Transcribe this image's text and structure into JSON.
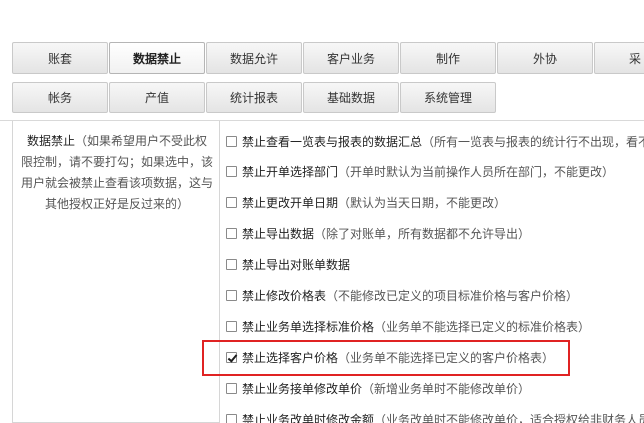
{
  "tabs_row1": [
    {
      "label": "账套",
      "active": false
    },
    {
      "label": "数据禁止",
      "active": true
    },
    {
      "label": "数据允许",
      "active": false
    },
    {
      "label": "客户业务",
      "active": false
    },
    {
      "label": "制作",
      "active": false
    },
    {
      "label": "外协",
      "active": false
    },
    {
      "label": "采",
      "active": false
    }
  ],
  "tabs_row2": [
    {
      "label": "帐务"
    },
    {
      "label": "产值"
    },
    {
      "label": "统计报表"
    },
    {
      "label": "基础数据"
    },
    {
      "label": "系统管理"
    }
  ],
  "section": {
    "title": "数据禁止",
    "description": "（如果希望用户不受此权限控制，请不要打勾；如果选中，该用户就会被禁止查看该项数据，这与其他授权正好是反过来的）"
  },
  "options": [
    {
      "label": "禁止查看一览表与报表的数据汇总",
      "desc": "（所有一览表与报表的统计行不出现，看不",
      "checked": false
    },
    {
      "label": "禁止开单选择部门",
      "desc": "（开单时默认为当前操作人员所在部门，不能更改）",
      "checked": false
    },
    {
      "label": "禁止更改开单日期",
      "desc": "（默认为当天日期，不能更改）",
      "checked": false
    },
    {
      "label": "禁止导出数据",
      "desc": "（除了对账单，所有数据都不允许导出）",
      "checked": false
    },
    {
      "label": "禁止导出对账单数据",
      "desc": "",
      "checked": false
    },
    {
      "label": "禁止修改价格表",
      "desc": "（不能修改已定义的项目标准价格与客户价格）",
      "checked": false
    },
    {
      "label": "禁止业务单选择标准价格",
      "desc": "（业务单不能选择已定义的标准价格表）",
      "checked": false
    },
    {
      "label": "禁止选择客户价格",
      "desc": "（业务单不能选择已定义的客户价格表）",
      "checked": true
    },
    {
      "label": "禁止业务接单修改单价",
      "desc": "（新增业务单时不能修改单价）",
      "checked": false
    },
    {
      "label": "禁止业务改单时修改金额",
      "desc": "（业务改单时不能修改单价，适合授权给非财务人员",
      "checked": false
    }
  ]
}
